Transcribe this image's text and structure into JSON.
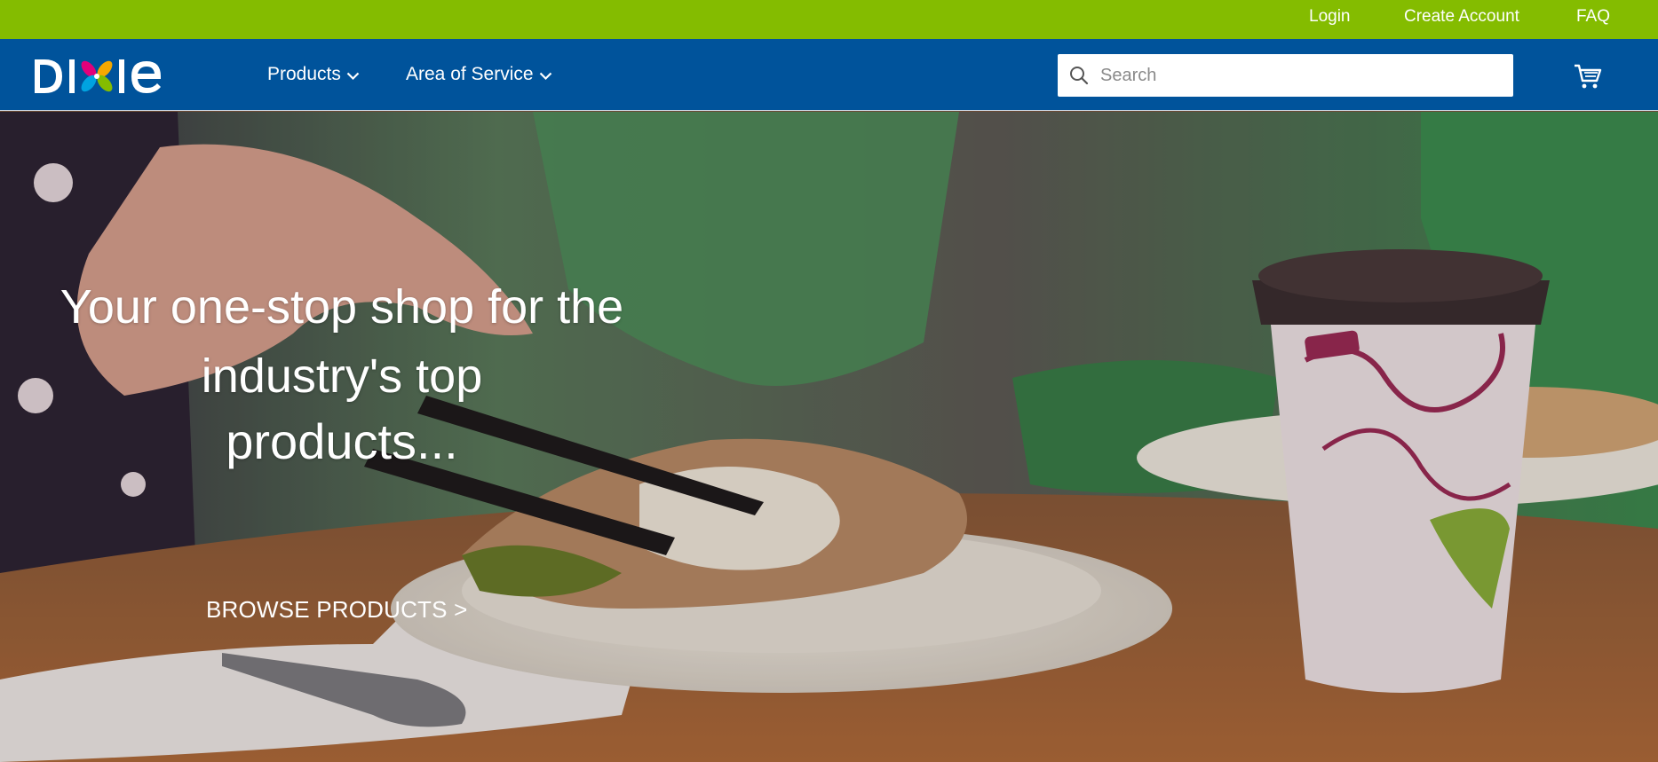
{
  "topbar": {
    "login": "Login",
    "create_account": "Create Account",
    "faq": "FAQ"
  },
  "brand": {
    "logo_text": "DIXIE",
    "colors": {
      "topbar": "#84bc00",
      "navbar": "#00539b"
    }
  },
  "nav": {
    "products": "Products",
    "area_of_service": "Area of Service"
  },
  "search": {
    "placeholder": "Search",
    "value": ""
  },
  "icons": {
    "search": "search-icon",
    "cart": "cart-icon",
    "chevron": "chevron-down-icon"
  },
  "hero": {
    "line1": "Your one-stop shop for the",
    "line2": "industry's top",
    "line3": "products...",
    "cta": "BROWSE PRODUCTS >"
  }
}
